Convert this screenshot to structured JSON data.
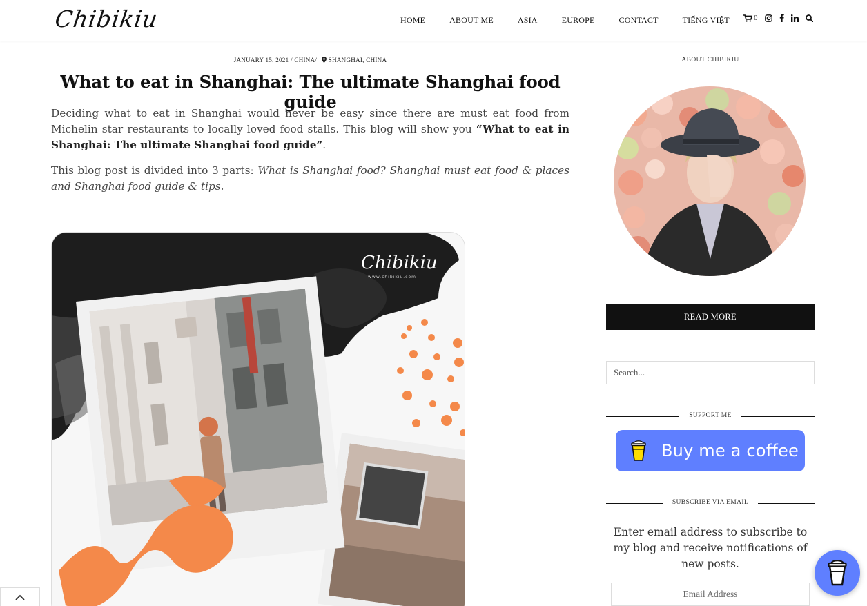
{
  "header": {
    "logo_text": "Chibikiu",
    "nav": [
      {
        "label": "HOME"
      },
      {
        "label": "ABOUT ME"
      },
      {
        "label": "ASIA"
      },
      {
        "label": "EUROPE"
      },
      {
        "label": "CONTACT"
      },
      {
        "label": "TIẾNG VIỆT"
      }
    ],
    "cart_count": "0",
    "icons": [
      "cart-icon",
      "instagram-icon",
      "facebook-icon",
      "linkedin-icon",
      "search-icon"
    ]
  },
  "post": {
    "date": "JANUARY 15, 2021",
    "separator": "/",
    "category": "CHINA",
    "location": "SHANGHAI, CHINA",
    "title": "What to eat in Shanghai: The ultimate Shanghai food guide",
    "para1_text": "Deciding what to eat in Shanghai would never be easy since there are must eat food from Michelin star restaurants to locally loved food stalls. This blog will show you ",
    "para1_bold": "“What to eat in Shanghai: The ultimate Shanghai food guide”",
    "para1_end": ".",
    "para2_text": "This blog post is divided into 3 parts: ",
    "para2_italic": "What is Shanghai food? Shanghai must eat food & places and Shanghai food guide & tips.",
    "image_watermark": "Chibikiu",
    "image_watermark_url": "www.chibikiu.com"
  },
  "sidebar": {
    "about_heading": "ABOUT CHIBIKIU",
    "read_more_label": "READ MORE",
    "search_placeholder": "Search...",
    "support_heading": "SUPPORT ME",
    "bmc_label": "Buy me a coffee",
    "subscribe_heading": "SUBSCRIBE VIA EMAIL",
    "subscribe_text": "Enter email address to subscribe to my blog and receive notifications of new posts.",
    "email_placeholder": "Email Address"
  },
  "colors": {
    "accent": "#5f7fff",
    "orange": "#f4894a",
    "dark": "#111111"
  }
}
